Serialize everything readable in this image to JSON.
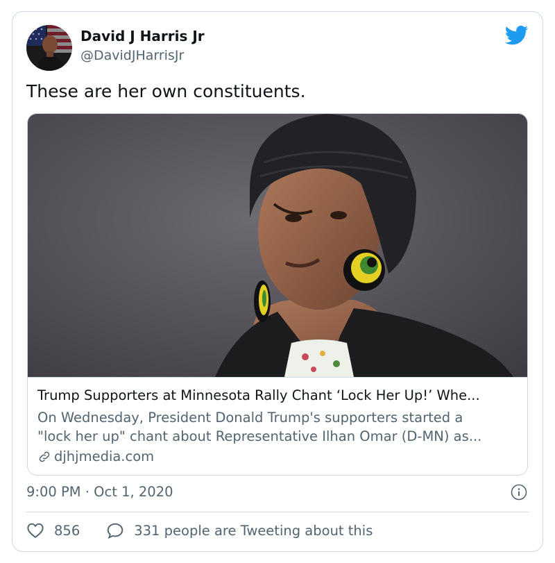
{
  "author": {
    "name": "David J Harris Jr",
    "handle": "@DavidJHarrisJr",
    "avatar_icon": "avatar-photo"
  },
  "brand_icon": "twitter-bird-icon",
  "tweet": {
    "text": "These are her own constituents."
  },
  "card": {
    "image_icon": "article-photo",
    "title": "Trump Supporters at Minnesota Rally Chant ‘Lock Her Up!’ Whe...",
    "description_line1": "On Wednesday, President Donald Trump's supporters started a",
    "description_line2": "\"lock her up\" chant about Representative Ilhan Omar (D-MN) as...",
    "domain": "djhjmedia.com",
    "link_icon": "link-icon"
  },
  "meta": {
    "timestamp": "9:00 PM · Oct 1, 2020",
    "info_icon": "info-icon"
  },
  "engagement": {
    "likes": "856",
    "retweet_text": "331 people are Tweeting about this"
  },
  "colors": {
    "brand": "#1d9bf0",
    "text": "#0f1419",
    "secondary": "#536471",
    "border": "#cfd9de"
  }
}
